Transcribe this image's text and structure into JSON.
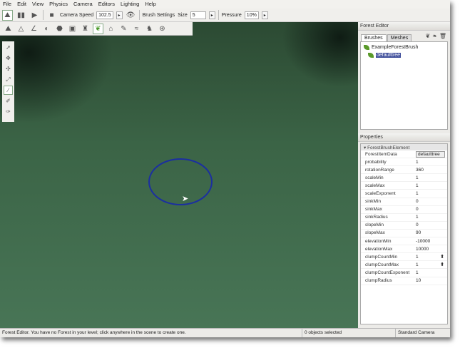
{
  "menu": [
    "File",
    "Edit",
    "View",
    "Physics",
    "Camera",
    "Editors",
    "Lighting",
    "Help"
  ],
  "toolbar": {
    "camera_speed_label": "Camera Speed",
    "camera_speed": "102.5",
    "brush_settings_label": "Brush Settings",
    "size_label": "Size",
    "size": "5",
    "pressure_label": "Pressure",
    "pressure": "10%",
    "arrow": "▸"
  },
  "forest_editor": {
    "title": "Forest Editor",
    "tabs": [
      "Brushes",
      "Meshes"
    ],
    "tree": [
      "ExampleForestBrush",
      "defaulttree"
    ]
  },
  "properties": {
    "title": "Properties",
    "group": "▾ ForestBrushElement",
    "rows": [
      [
        "ForestItemData",
        "defaulttree"
      ],
      [
        "probability",
        "1"
      ],
      [
        "rotationRange",
        "360"
      ],
      [
        "scaleMin",
        "1"
      ],
      [
        "scaleMax",
        "1"
      ],
      [
        "scaleExponent",
        "1"
      ],
      [
        "sinkMin",
        "0"
      ],
      [
        "sinkMax",
        "0"
      ],
      [
        "sinkRadius",
        "1"
      ],
      [
        "slopeMin",
        "0"
      ],
      [
        "slopeMax",
        "90"
      ],
      [
        "elevationMin",
        "-10000"
      ],
      [
        "elevationMax",
        "10000"
      ],
      [
        "clumpCountMin",
        "1"
      ],
      [
        "clumpCountMax",
        "1"
      ],
      [
        "clumpCountExponent",
        "1"
      ],
      [
        "clumpRadius",
        "10"
      ]
    ]
  },
  "status": {
    "message": "Forest Editor. You have no Forest in your level; click anywhere in the scene to create one.",
    "selection": "0 objects selected",
    "camera": "Standard Camera"
  }
}
